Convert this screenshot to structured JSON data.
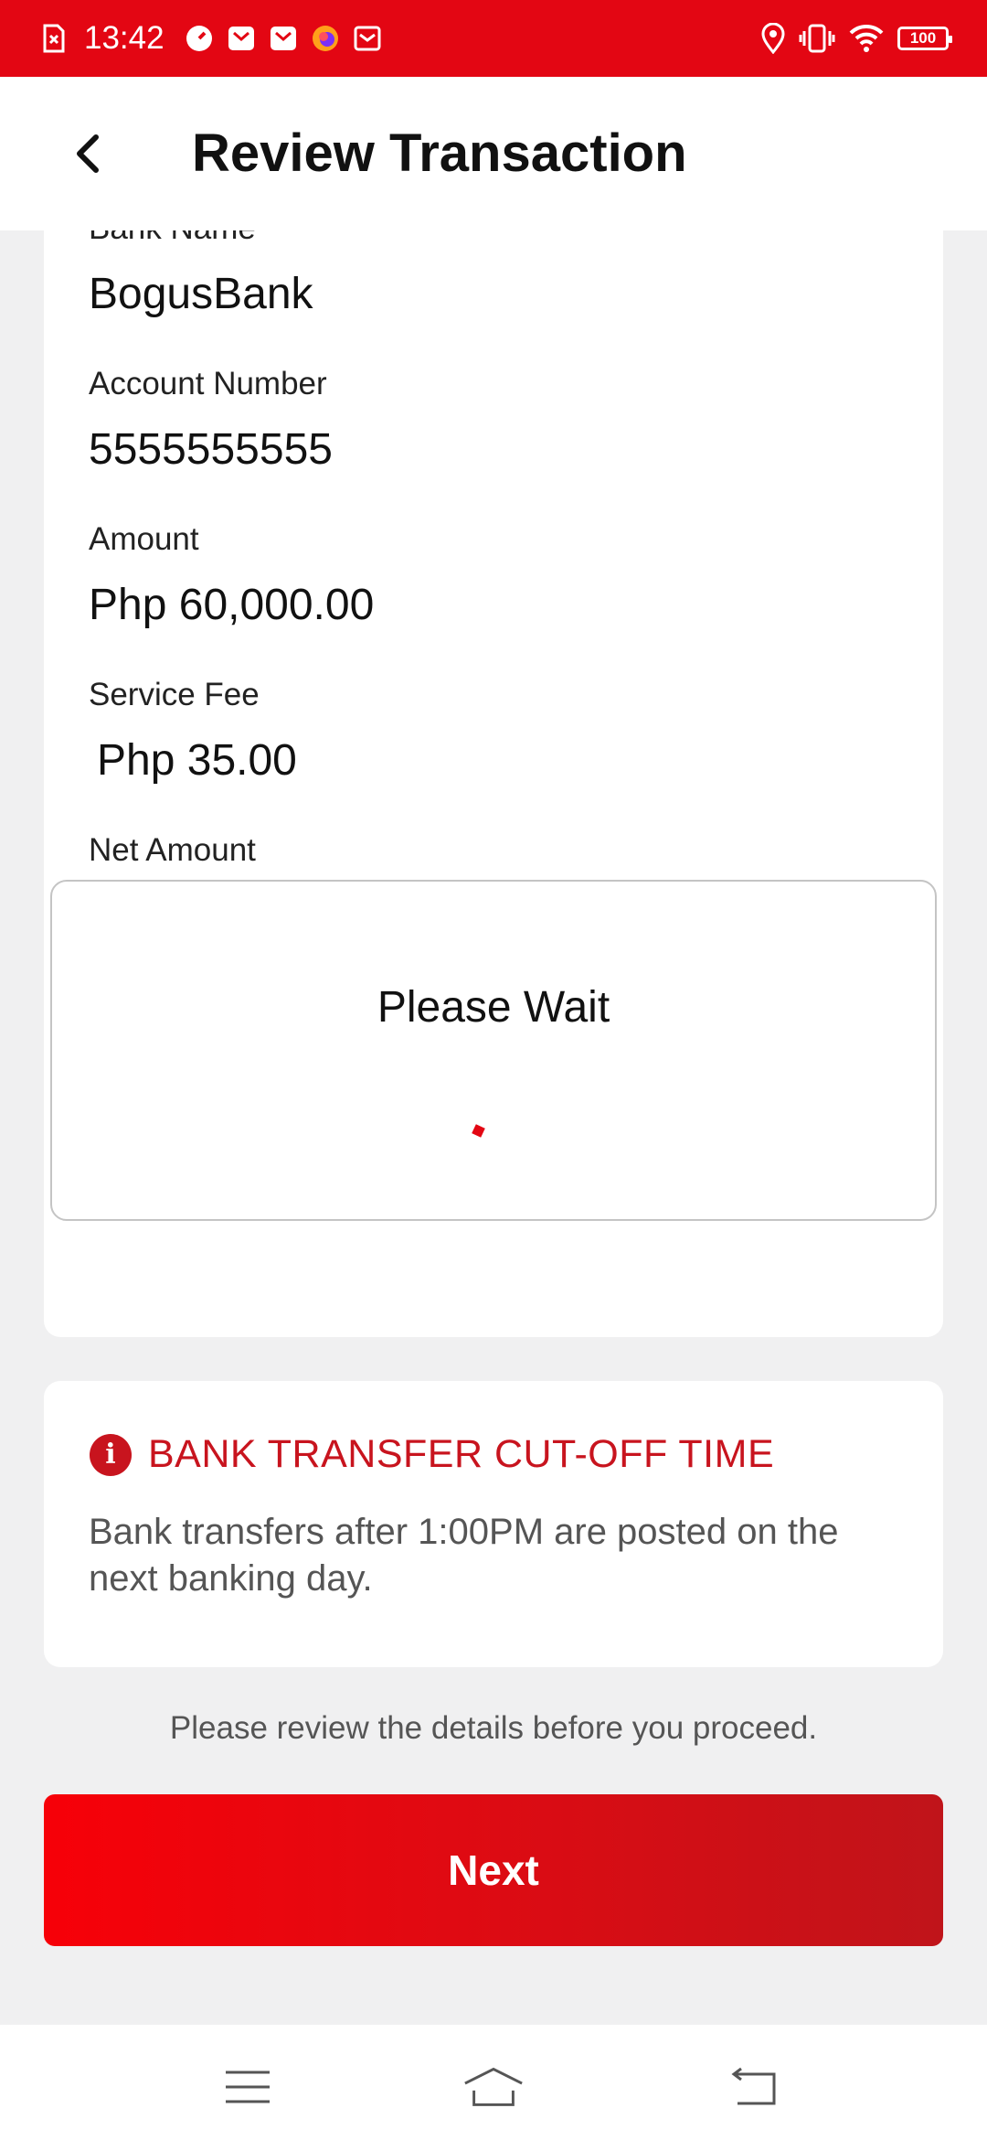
{
  "status_bar": {
    "time": "13:42",
    "battery": "100",
    "icons": [
      "sim-card-icon",
      "clock-app-icon",
      "mail-icon",
      "mail-icon",
      "firefox-icon",
      "inbox-icon",
      "location-icon",
      "vibrate-icon",
      "wifi-icon",
      "battery-icon"
    ]
  },
  "header": {
    "title": "Review Transaction",
    "back_icon": "chevron-left-icon"
  },
  "details": {
    "bank_name_label": "Bank Name",
    "bank_name_value": "BogusBank",
    "account_number_label": "Account Number",
    "account_number_value": "5555555555",
    "amount_label": "Amount",
    "amount_value": "Php 60,000.00",
    "service_fee_label": "Service Fee",
    "service_fee_value": "Php 35.00",
    "net_amount_label": "Net Amount"
  },
  "wait_dialog": {
    "title": "Please Wait"
  },
  "cutoff": {
    "title": "BANK TRANSFER CUT-OFF TIME",
    "body": "Bank transfers after 1:00PM are posted on the next banking day."
  },
  "review_note": "Please review the details before you proceed.",
  "next_label": "Next",
  "colors": {
    "brand_red": "#e30613",
    "alert_red": "#c8141e",
    "background": "#f0f0f1"
  }
}
